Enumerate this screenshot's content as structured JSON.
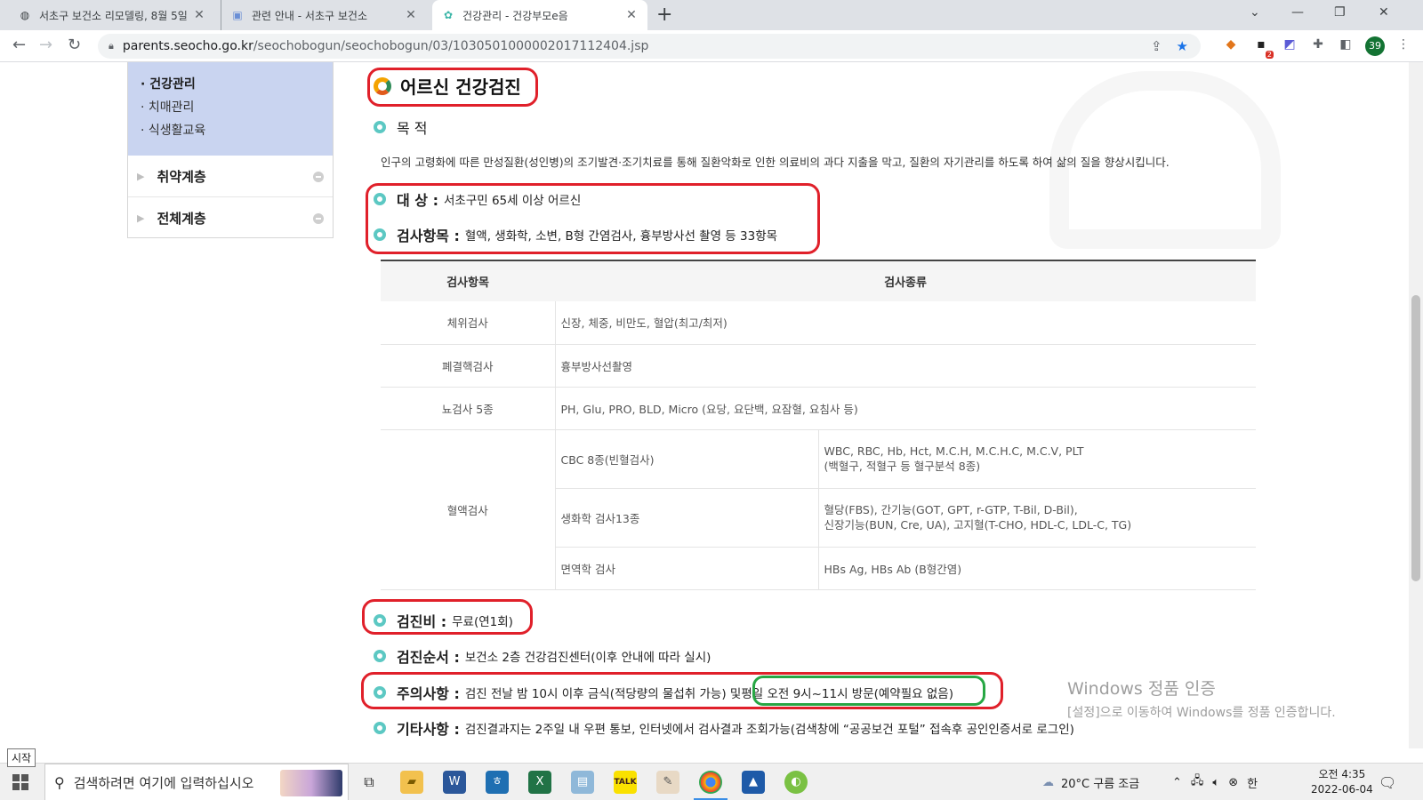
{
  "browser": {
    "tabs": [
      {
        "title": "서초구 보건소 리모델링, 8월 5일",
        "icon": "globe-icon"
      },
      {
        "title": "관련 안내 - 서초구 보건소",
        "icon": "page-icon"
      },
      {
        "title": "건강관리 - 건강부모e음",
        "icon": "site-icon"
      }
    ],
    "url_host": "parents.seocho.go.kr",
    "url_path": "/seochobogun/seochobogun/03/1030501000002017112404.jsp",
    "profile_badge": "39",
    "ext_badge": "2"
  },
  "sidebar": {
    "sub_items": [
      "· 건강관리",
      "· 치매관리",
      "· 식생활교육"
    ],
    "menu": [
      "취약계층",
      "전체계층"
    ]
  },
  "content": {
    "title": "어르신 건강검진",
    "purpose_label": "목 적",
    "purpose_text": "인구의 고령화에 따른 만성질환(성인병)의 조기발견·조기치료를 통해 질환악화로 인한 의료비의 과다 지출을 막고, 질환의 자기관리를 하도록 하여 삶의 질을 향상시킵니다.",
    "target_label": "대 상 :",
    "target_value": "서초구민 65세 이상 어르신",
    "items_label": "검사항목 :",
    "items_value": "혈액, 생화학, 소변, B형 간염검사, 흉부방사선 촬영 등 33항목",
    "table": {
      "headers": [
        "검사항목",
        "검사종류"
      ],
      "rows": [
        {
          "item": "체위검사",
          "type": "신장, 체중, 비만도, 혈압(최고/최저)"
        },
        {
          "item": "폐결핵검사",
          "type": "흉부방사선촬영"
        },
        {
          "item": "뇨검사 5종",
          "type": "PH, Glu, PRO, BLD, Micro (요당, 요단백, 요잠혈, 요침사 등)"
        }
      ],
      "blood": {
        "item": "혈액검사",
        "rows": [
          {
            "sub": "CBC 8종(빈혈검사)",
            "l1": "WBC, RBC, Hb, Hct, M.C.H, M.C.H.C, M.C.V, PLT",
            "l2": "(백혈구, 적혈구 등 혈구분석 8종)"
          },
          {
            "sub": "생화학 검사13종",
            "l1": "혈당(FBS), 간기능(GOT, GPT, r-GTP, T-Bil, D-Bil),",
            "l2": "신장기능(BUN, Cre, UA), 고지혈(T-CHO, HDL-C, LDL-C, TG)"
          },
          {
            "sub": "면역학 검사",
            "l1": "HBs Ag, HBs Ab (B형간염)",
            "l2": ""
          }
        ]
      }
    },
    "fee_label": "검진비 :",
    "fee_value": "무료(연1회)",
    "order_label": "검진순서 :",
    "order_value": "보건소 2층 건강검진센터(이후 안내에 따라 실시)",
    "caution_label": "주의사항 :",
    "caution_value": "검진 전날 밤 10시 이후 금식(적당량의 물섭취 가능) 및 ",
    "caution_highlight": "평일 오전 9시~11시 방문(예약필요 없음)",
    "etc_label": "기타사항 :",
    "etc_value": "검진결과지는 2주일 내 우편 통보, 인터넷에서 검사결과 조회가능(검색창에 “공공보건 포털” 접속후 공인인증서로 로그인)"
  },
  "watermark": {
    "line1": "Windows 정품 인증",
    "line2": "[설정]으로 이동하여 Windows를 정품 인증합니다."
  },
  "taskbar": {
    "start_tooltip": "시작",
    "search_placeholder": "검색하려면 여기에 입력하십시오",
    "weather": "20°C  구름 조금",
    "ime": "한",
    "time": "오전 4:35",
    "date": "2022-06-04"
  },
  "colors": {
    "annotation_red": "#e0202a",
    "annotation_green": "#27a744",
    "sidebar_highlight": "#c9d4f0",
    "bullet_teal": "#5cc8c3"
  }
}
